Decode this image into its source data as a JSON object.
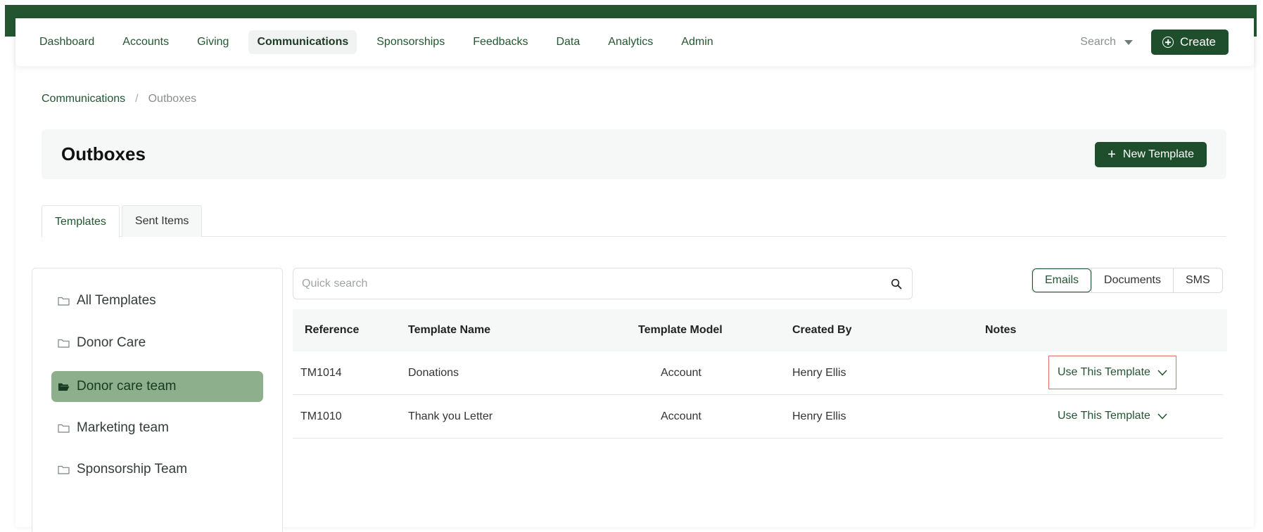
{
  "nav": {
    "items": [
      "Dashboard",
      "Accounts",
      "Giving",
      "Communications",
      "Sponsorships",
      "Feedbacks",
      "Data",
      "Analytics",
      "Admin"
    ],
    "active": "Communications",
    "search_label": "Search",
    "create_label": "Create"
  },
  "breadcrumb": {
    "parent": "Communications",
    "separator": "/",
    "current": "Outboxes"
  },
  "page": {
    "title": "Outboxes",
    "new_template_label": "New Template"
  },
  "tabs": {
    "templates": "Templates",
    "sent_items": "Sent Items",
    "active": "Templates"
  },
  "folders": {
    "items": [
      "All Templates",
      "Donor Care",
      "Donor care team",
      "Marketing team",
      "Sponsorship Team"
    ],
    "active": "Donor care team"
  },
  "search": {
    "placeholder": "Quick search",
    "value": ""
  },
  "doc_types": {
    "items": [
      "Emails",
      "Documents",
      "SMS"
    ],
    "active": "Emails"
  },
  "table": {
    "headers": {
      "reference": "Reference",
      "template_name": "Template Name",
      "template_model": "Template Model",
      "created_by": "Created By",
      "notes": "Notes"
    },
    "rows": [
      {
        "reference": "TM1014",
        "template_name": "Donations",
        "template_model": "Account",
        "created_by": "Henry Ellis",
        "notes": "",
        "action": "Use This Template"
      },
      {
        "reference": "TM1010",
        "template_name": "Thank you Letter",
        "template_model": "Account",
        "created_by": "Henry Ellis",
        "notes": "",
        "action": "Use This Template"
      }
    ]
  },
  "colors": {
    "brand_green": "#1f4e2c",
    "active_folder": "#8daf8c",
    "highlight_border": "#e46b6b"
  }
}
